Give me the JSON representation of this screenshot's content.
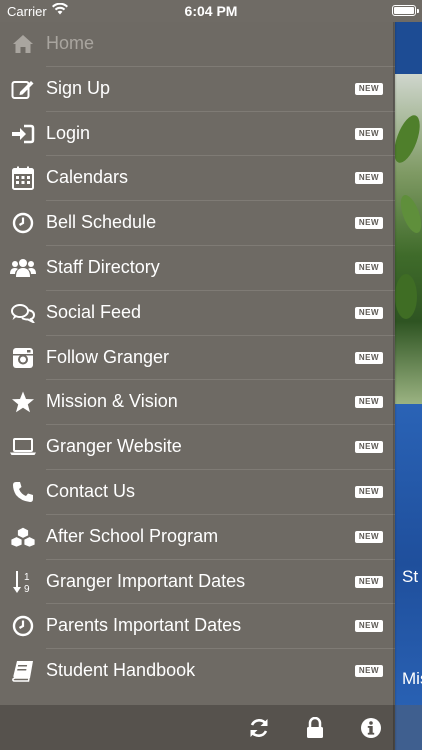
{
  "status_bar": {
    "carrier": "Carrier",
    "time": "6:04 PM"
  },
  "menu": {
    "badge_label": "NEW",
    "items": [
      {
        "label": "Home",
        "icon": "home-icon",
        "badge": false,
        "disabled": true
      },
      {
        "label": "Sign Up",
        "icon": "edit-icon",
        "badge": true
      },
      {
        "label": "Login",
        "icon": "sign-in-icon",
        "badge": true
      },
      {
        "label": "Calendars",
        "icon": "calendar-icon",
        "badge": true
      },
      {
        "label": "Bell Schedule",
        "icon": "clock-icon",
        "badge": true
      },
      {
        "label": "Staff Directory",
        "icon": "users-icon",
        "badge": true
      },
      {
        "label": "Social Feed",
        "icon": "comments-icon",
        "badge": true
      },
      {
        "label": "Follow Granger",
        "icon": "instagram-icon",
        "badge": true
      },
      {
        "label": "Mission & Vision",
        "icon": "star-icon",
        "badge": true
      },
      {
        "label": "Granger Website",
        "icon": "laptop-icon",
        "badge": true
      },
      {
        "label": "Contact Us",
        "icon": "phone-icon",
        "badge": true
      },
      {
        "label": "After School Program",
        "icon": "cubes-icon",
        "badge": true
      },
      {
        "label": "Granger Important Dates",
        "icon": "sort-numeric-icon",
        "badge": true
      },
      {
        "label": "Parents Important Dates",
        "icon": "clock-icon",
        "badge": true
      },
      {
        "label": "Student Handbook",
        "icon": "book-icon",
        "badge": true
      }
    ]
  },
  "footer": {
    "icons": [
      "refresh-icon",
      "lock-icon",
      "info-icon"
    ]
  },
  "background_app": {
    "tile_text_1": "St",
    "tile_text_2": "Mis"
  },
  "colors": {
    "drawer": "#6e6a64",
    "footer": "#56524d",
    "app_blue": "#1e4f9a"
  }
}
